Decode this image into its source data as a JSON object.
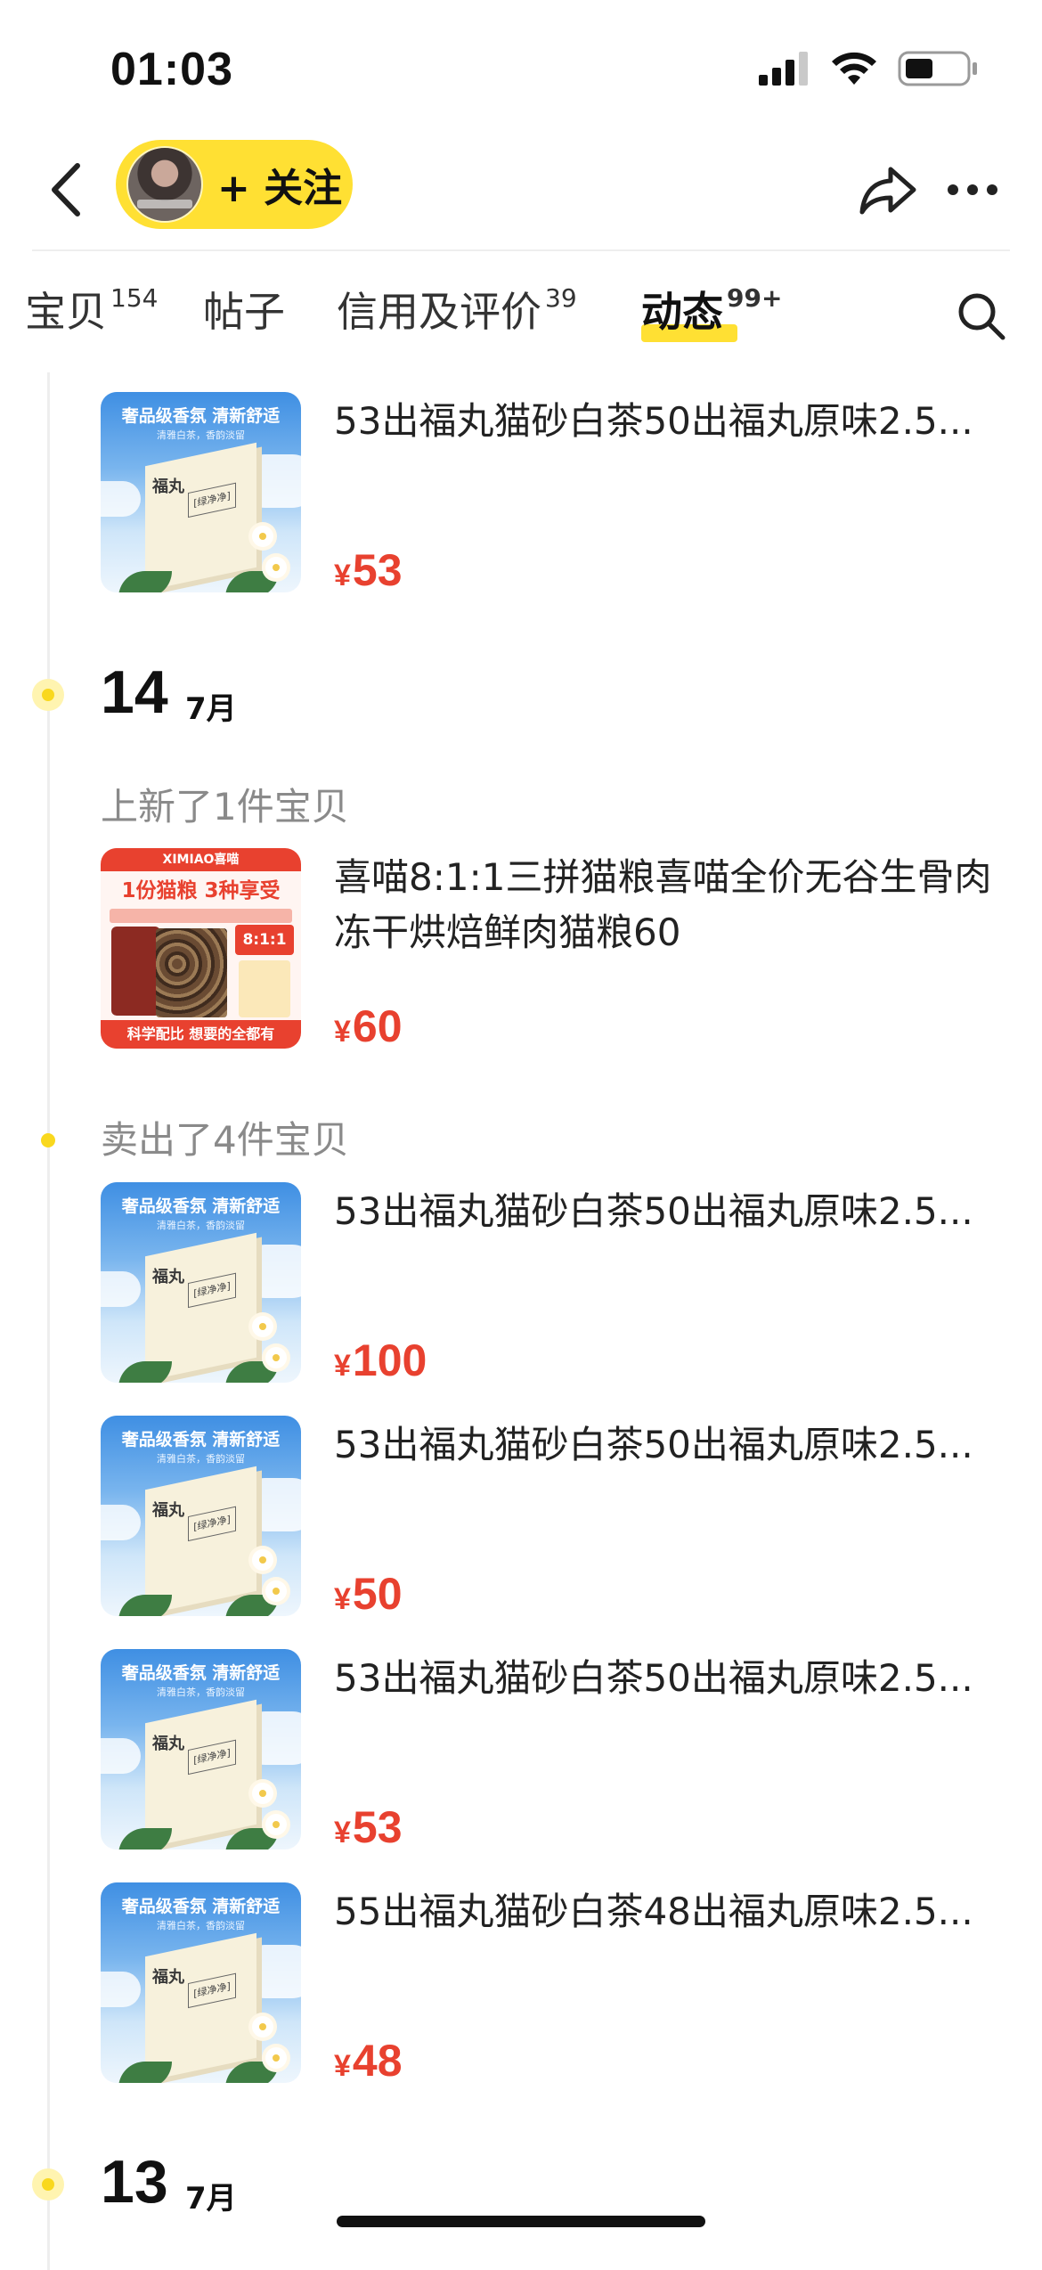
{
  "status_bar": {
    "time": "01:03"
  },
  "nav": {
    "follow_label": "+ 关注"
  },
  "tabs": [
    {
      "label": "宝贝",
      "count": "154"
    },
    {
      "label": "帖子",
      "count": ""
    },
    {
      "label": "信用及评价",
      "count": "39"
    },
    {
      "label": "动态",
      "count": "99+",
      "active": true
    }
  ],
  "colors": {
    "accent": "#ffe033",
    "price": "#e8412f",
    "timeline_dot": "#f9d81e"
  },
  "icons": [
    "back-arrow-icon",
    "share-icon",
    "more-icon",
    "search-icon"
  ],
  "litter_thumb": {
    "caption": "奢品级香氛 清新舒适",
    "subcaption": "清雅白茶，香韵淡留",
    "brand": "福丸",
    "tag": "[绿净净]"
  },
  "food_thumb": {
    "top": "XIMIAO喜喵",
    "headline": "1份猫粮 3种享受",
    "ratio": "8:1:1",
    "bottom": "科学配比 想要的全都有"
  },
  "timeline": {
    "top_item": {
      "title": "53出福丸猫砂白茶50出福丸原味2.5...",
      "currency": "¥",
      "price": "53"
    },
    "day14": {
      "day": "14",
      "month": "7月",
      "new_label": "上新了1件宝贝",
      "new_item": {
        "title": "喜喵8:1:1三拼猫粮喜喵全价无谷生骨肉冻干烘焙鲜肉猫粮60",
        "currency": "¥",
        "price": "60"
      },
      "sold_label": "卖出了4件宝贝",
      "sold_items": [
        {
          "title": "53出福丸猫砂白茶50出福丸原味2.5...",
          "currency": "¥",
          "price": "100"
        },
        {
          "title": "53出福丸猫砂白茶50出福丸原味2.5...",
          "currency": "¥",
          "price": "50"
        },
        {
          "title": "53出福丸猫砂白茶50出福丸原味2.5...",
          "currency": "¥",
          "price": "53"
        },
        {
          "title": "55出福丸猫砂白茶48出福丸原味2.5...",
          "currency": "¥",
          "price": "48"
        }
      ]
    },
    "day13": {
      "day": "13",
      "month": "7月"
    }
  }
}
